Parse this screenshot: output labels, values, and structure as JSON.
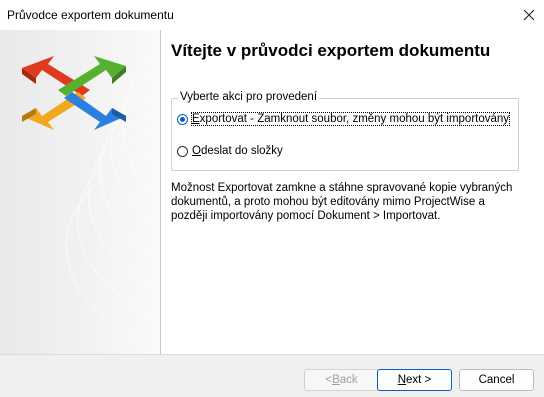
{
  "window": {
    "title": "Průvodce exportem dokumentu"
  },
  "page": {
    "heading": "Vítejte v průvodci exportem dokumentu",
    "group_label": "Vyberte akci pro provedení",
    "options": [
      {
        "label_key": "E",
        "label_rest": "xportovat - Zamknout soubor, změny mohou být importovány",
        "selected": true
      },
      {
        "label_key": "O",
        "label_rest": "deslat do složky",
        "selected": false
      }
    ],
    "description": "Možnost Exportovat zamkne a stáhne spravované kopie vybraných dokumentů, a proto mohou být editovány mimo ProjectWise a později importovány pomocí Dokument > Importovat."
  },
  "footer": {
    "back_prefix": "< ",
    "back_key": "B",
    "back_rest": "ack",
    "next_key": "N",
    "next_rest": "ext >",
    "cancel": "Cancel"
  },
  "colors": {
    "accent": "#0a5fc4",
    "arrow_red": "#e03a1e",
    "arrow_green": "#58b030",
    "arrow_yellow": "#f0a820",
    "arrow_blue": "#2a7fe0"
  }
}
